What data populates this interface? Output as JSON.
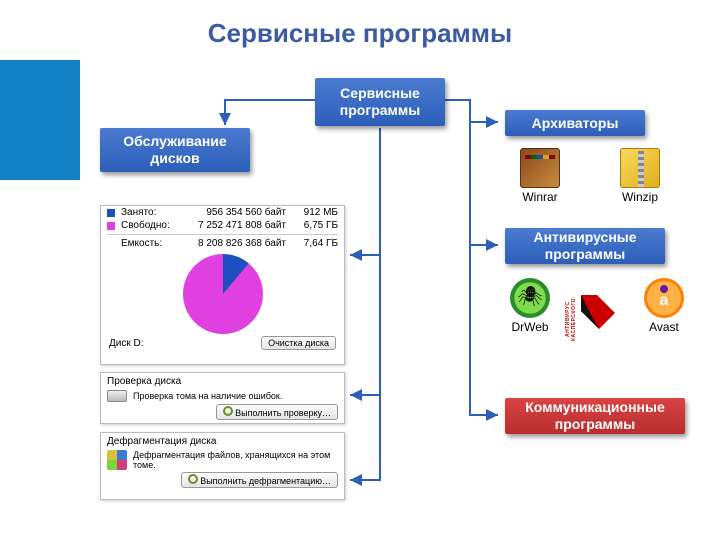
{
  "title": "Сервисные программы",
  "nodes": {
    "root": "Сервисные программы",
    "disk": "Обслуживание дисков",
    "arch": "Архиваторы",
    "av": "Антивирусные программы",
    "comm": "Коммуникационные программы"
  },
  "archivers": {
    "winrar": "Winrar",
    "winzip": "Winzip"
  },
  "antivirus": {
    "drweb": "DrWeb",
    "kasper": "КАСПЕРСКОГО",
    "kasper_pre": "АНТИВИРУС",
    "avast": "Avast"
  },
  "diskinfo": {
    "used_label": "Занято:",
    "used_bytes": "956 354 560 байт",
    "used_h": "912 МБ",
    "free_label": "Свободно:",
    "free_bytes": "7 252 471 808 байт",
    "free_h": "6,75 ГБ",
    "cap_label": "Емкость:",
    "cap_bytes": "8 208 826 368 байт",
    "cap_h": "7,64 ГБ",
    "drive": "Диск D:",
    "cleanup": "Очистка диска"
  },
  "check": {
    "title": "Проверка диска",
    "desc": "Проверка тома на наличие ошибок.",
    "btn": "Выполнить проверку…"
  },
  "defrag": {
    "title": "Дефрагментация диска",
    "desc": "Дефрагментация файлов, хранящихся на этом томе.",
    "btn": "Выполнить дефрагментацию…"
  }
}
